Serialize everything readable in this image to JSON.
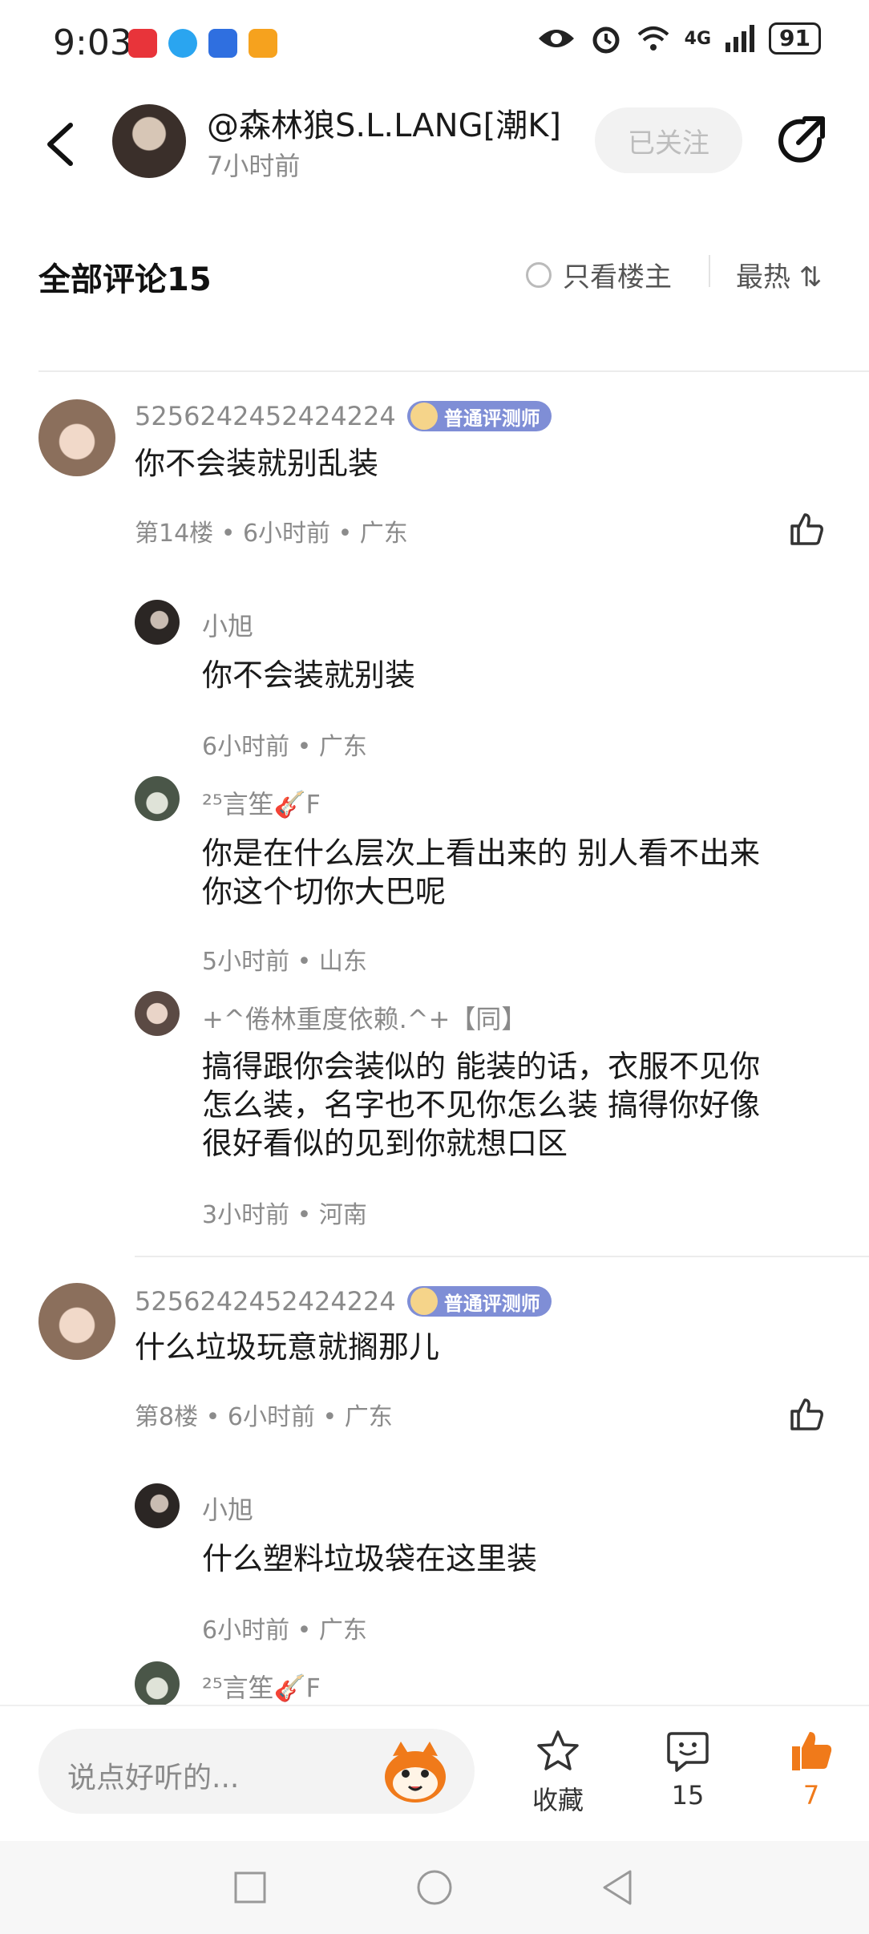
{
  "status_bar": {
    "time": "9:03",
    "network": "4G",
    "battery": "91",
    "icons": [
      "eye-icon",
      "alarm-icon",
      "wifi-icon",
      "signal-icon"
    ]
  },
  "header": {
    "author": "@森林狼S.L.LANG[潮K]",
    "time": "7小时前",
    "follow_label": "已关注"
  },
  "comments_header": {
    "title": "全部评论15",
    "op_only": "只看楼主",
    "sort": "最热 ⇅"
  },
  "comments": [
    {
      "user": "5256242452424224",
      "badge": "普通评测师",
      "text": "你不会装就别乱装",
      "meta": "第14楼 • 6小时前 • 广东",
      "replies": [
        {
          "user": "小旭",
          "text": "你不会装就别装",
          "meta": "6小时前 • 广东"
        },
        {
          "user": "²⁵言笙🎸F",
          "text_lines": [
            "你是在什么层次上看出来的  别人看不出来",
            "你这个切你大巴呢"
          ],
          "meta": "5小时前 • 山东"
        },
        {
          "user": "+^倦林重度依赖.^+【同】",
          "text_lines": [
            "搞得跟你会装似的 能装的话，衣服不见你",
            "怎么装，名字也不见你怎么装 搞得你好像",
            "很好看似的见到你就想口区"
          ],
          "meta": "3小时前 • 河南"
        }
      ]
    },
    {
      "user": "5256242452424224",
      "badge": "普通评测师",
      "text": "什么垃圾玩意就搁那儿",
      "meta": "第8楼 • 6小时前 • 广东",
      "replies": [
        {
          "user": "小旭",
          "text": "什么塑料垃圾袋在这里装",
          "meta": "6小时前 • 广东"
        },
        {
          "user": "²⁵言笙🎸F"
        }
      ]
    }
  ],
  "bottom_bar": {
    "placeholder": "说点好听的...",
    "favorite_label": "收藏",
    "comment_count": "15",
    "like_count": "7"
  },
  "colors": {
    "accent_orange": "#f07a1a",
    "badge_purple": "#7f8ed6",
    "muted_text": "#8b8b8b"
  }
}
